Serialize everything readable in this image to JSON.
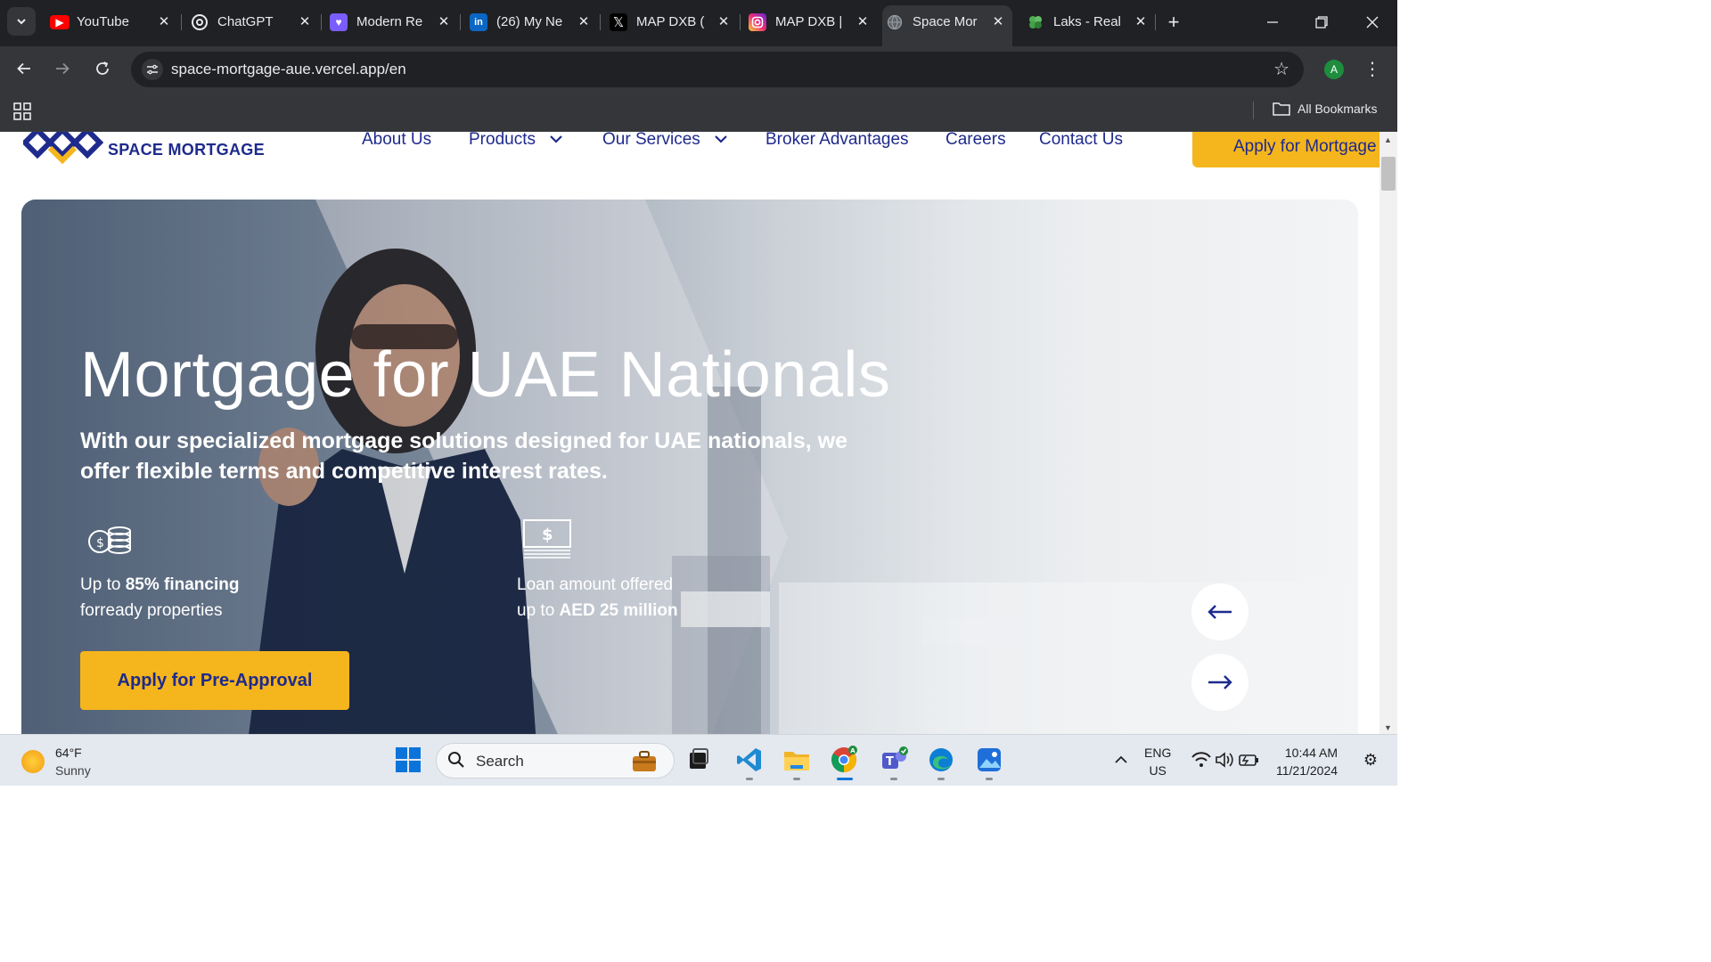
{
  "browser": {
    "tabs": [
      {
        "title": "YouTube",
        "icon": "youtube-icon",
        "color": "#ff0000"
      },
      {
        "title": "ChatGPT",
        "icon": "chatgpt-icon",
        "color": "#202124"
      },
      {
        "title": "Modern Re",
        "icon": "heart-chat-icon",
        "color": "#7b5cff"
      },
      {
        "title": "(26) My Ne",
        "icon": "linkedin-icon",
        "color": "#0a66c2"
      },
      {
        "title": "MAP DXB (",
        "icon": "x-icon",
        "color": "#000000"
      },
      {
        "title": "MAP DXB |",
        "icon": "instagram-icon",
        "color": "#d62976"
      },
      {
        "title": "Space Mor",
        "icon": "globe-icon",
        "color": "#9aa0a6",
        "active": true
      },
      {
        "title": "Laks - Real",
        "icon": "clover-icon",
        "color": "#4caf50"
      }
    ],
    "url": "space-mortgage-aue.vercel.app/en",
    "profile_initial": "A",
    "bookmarks_label": "All Bookmarks"
  },
  "site": {
    "logo_text": "SPACE MORTGAGE",
    "nav": {
      "about": "About Us",
      "products": "Products",
      "services": "Our Services",
      "broker": "Broker Advantages",
      "careers": "Careers",
      "contact": "Contact Us"
    },
    "apply_top": "Apply for Mortgage",
    "hero": {
      "title": "Mortgage for UAE Nationals",
      "subtitle": "With our specialized mortgage solutions designed for UAE nationals, we offer flexible terms and competitive interest rates.",
      "feature1": {
        "pre": "Up to ",
        "bold": "85% financing",
        "line2": "forready properties"
      },
      "feature2": {
        "line1": "Loan amount offered",
        "pre": "up to ",
        "bold": "AED 25 million"
      },
      "cta": "Apply for Pre-Approval"
    }
  },
  "taskbar": {
    "temperature": "64°F",
    "condition": "Sunny",
    "search_label": "Search",
    "language": "ENG",
    "region": "US",
    "time": "10:44 AM",
    "date": "11/21/2024"
  },
  "colors": {
    "brand_navy": "#1e2a8c",
    "brand_gold": "#f5b51c"
  }
}
